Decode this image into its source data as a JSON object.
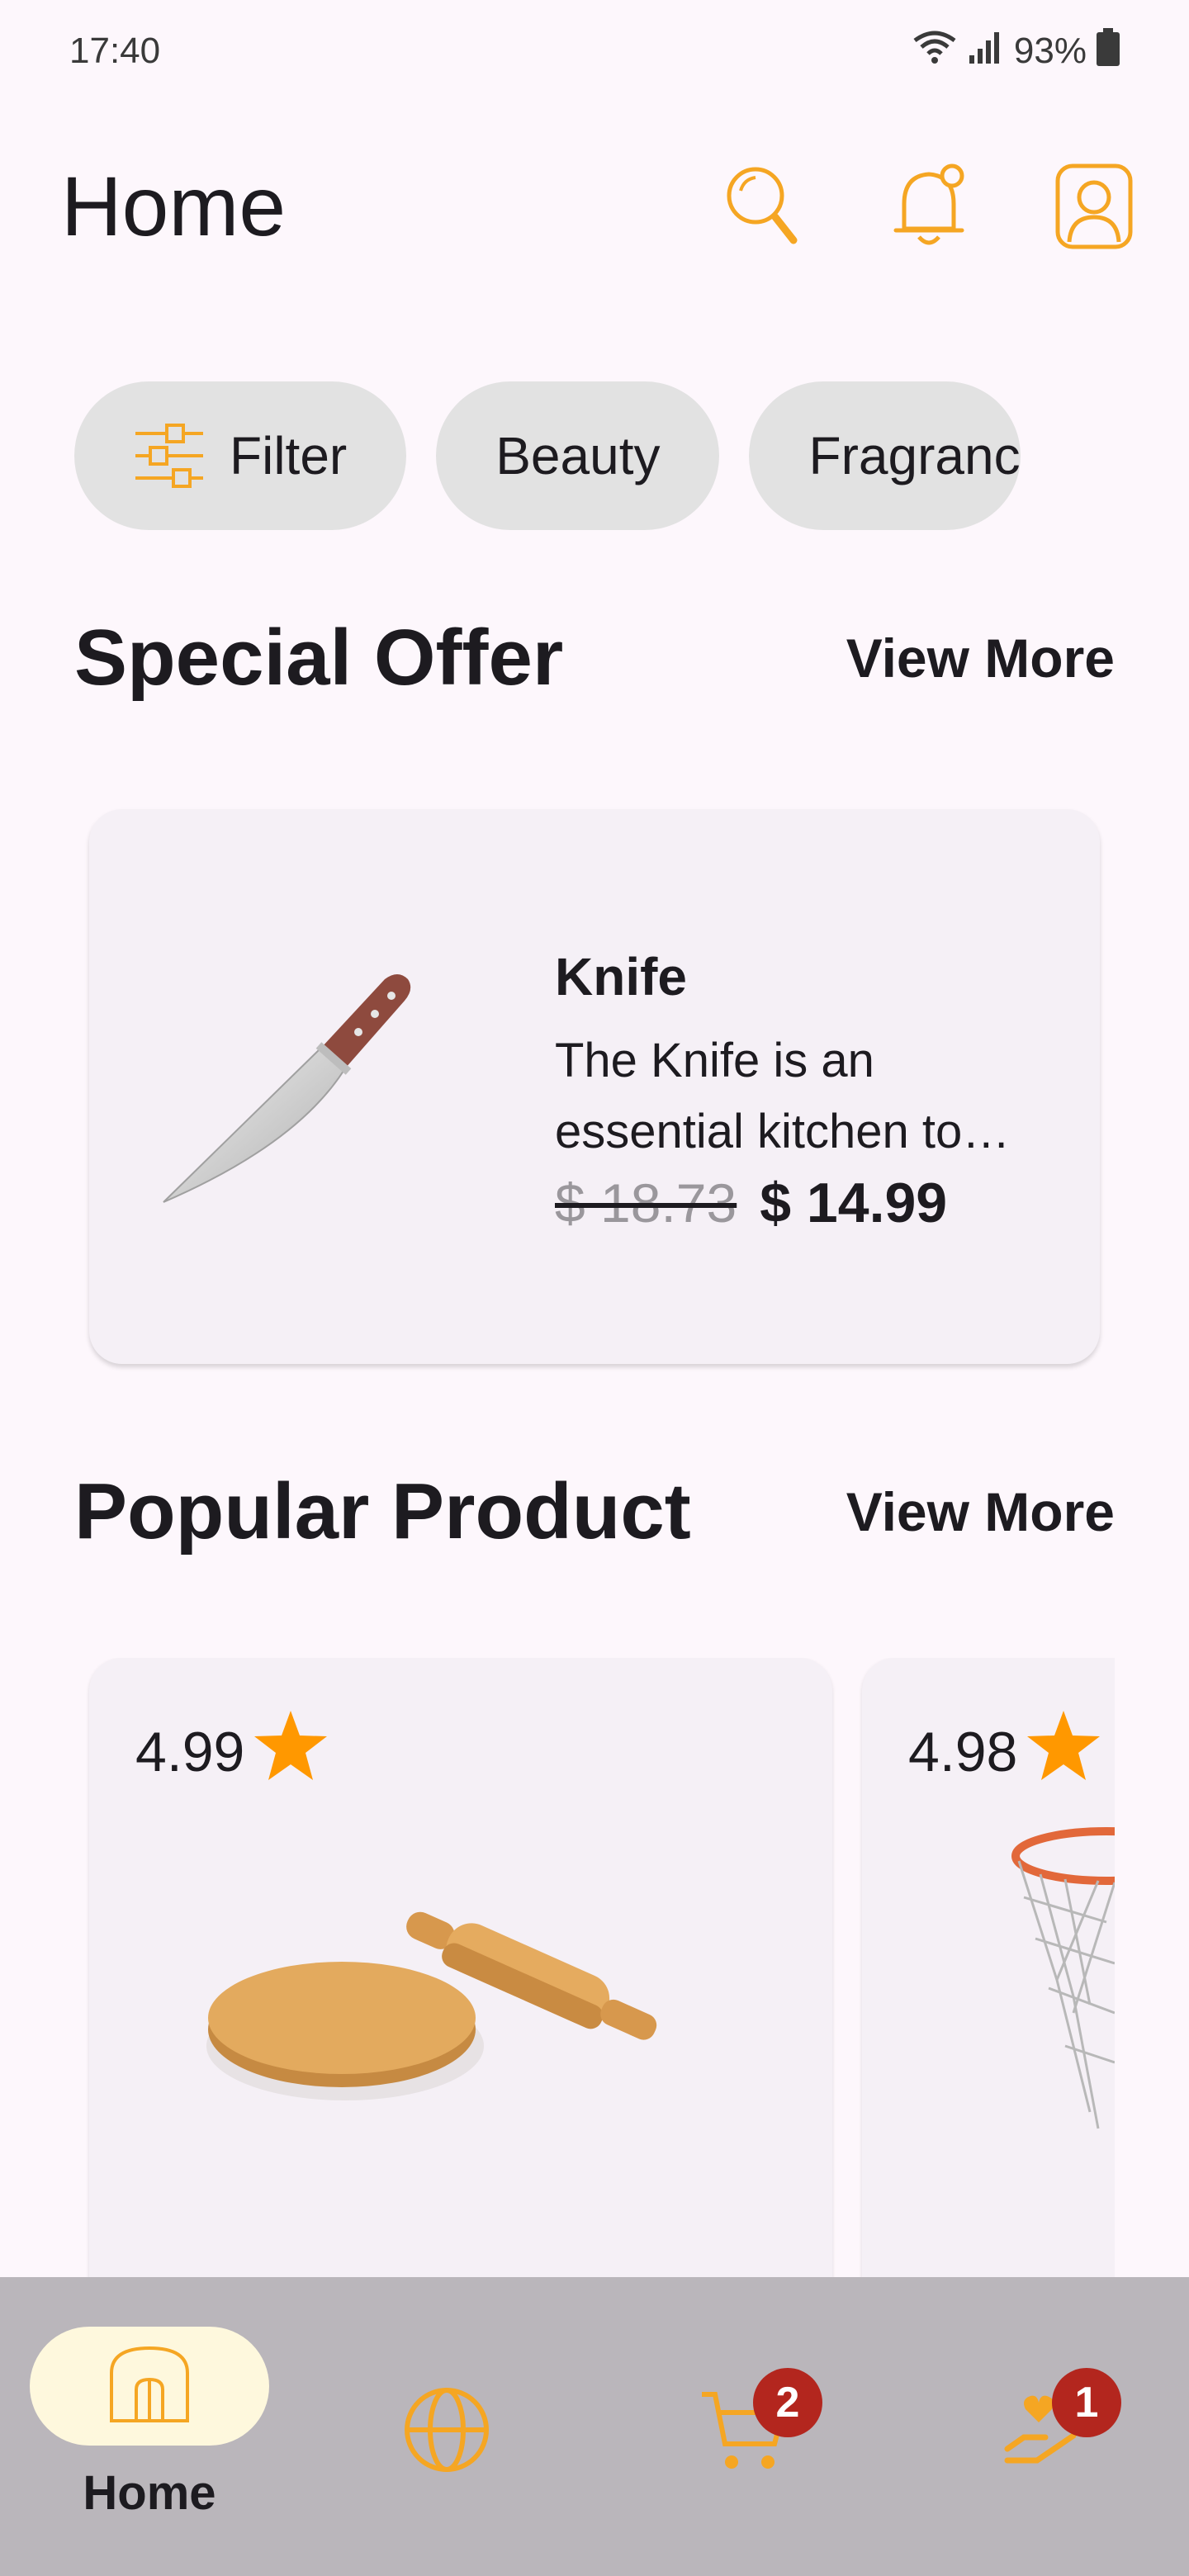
{
  "status_bar": {
    "time": "17:40",
    "battery": "93%"
  },
  "app_bar": {
    "title": "Home"
  },
  "chips": [
    {
      "label": "Filter",
      "icon": "filter-icon"
    },
    {
      "label": "Beauty"
    },
    {
      "label": "Fragranc"
    }
  ],
  "special_offer": {
    "title": "Special Offer",
    "view_more": "View More",
    "product": {
      "name": "Knife",
      "description": "The Knife is an essential kitchen to…",
      "old_price": "$ 18.73",
      "new_price": "$ 14.99"
    }
  },
  "popular": {
    "title": "Popular Product",
    "view_more": "View More",
    "products": [
      {
        "rating": "4.99",
        "image": "rolling-pin-and-board"
      },
      {
        "rating": "4.98",
        "image": "basketball-hoop"
      }
    ]
  },
  "bottom_nav": {
    "home_label": "Home",
    "cart_badge": "2",
    "donate_badge": "1"
  },
  "colors": {
    "accent": "#f5a623",
    "star": "#ff9800",
    "badge": "#b3261e"
  }
}
